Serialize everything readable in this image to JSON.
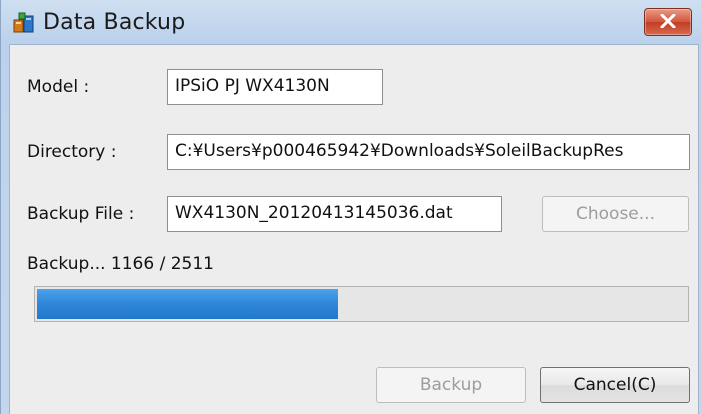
{
  "window": {
    "title": "Data Backup",
    "icon": "data-backup-app-icon",
    "close_icon": "close-icon"
  },
  "form": {
    "model_label": "Model :",
    "model_value": "IPSiO PJ WX4130N",
    "directory_label": "Directory :",
    "directory_value": "C:¥Users¥p000465942¥Downloads¥SoleilBackupRes",
    "backup_file_label": "Backup File :",
    "backup_file_value": "WX4130N_20120413145036.dat",
    "choose_button": "Choose..."
  },
  "progress": {
    "status_text": "Backup... 1166 / 2511",
    "current": 1166,
    "total": 2511
  },
  "buttons": {
    "backup": "Backup",
    "cancel": "Cancel(C)"
  },
  "colors": {
    "progress_fill": "#2f86d8",
    "close_button": "#c9452b"
  }
}
